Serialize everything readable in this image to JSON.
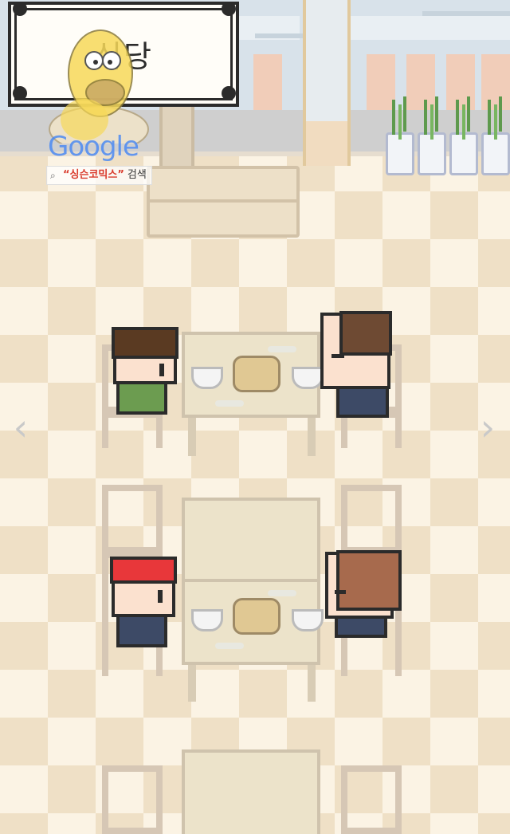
{
  "sign": {
    "title": "식당"
  },
  "navigation": {
    "prev_icon": "chevron-left-icon",
    "next_icon": "chevron-right-icon",
    "prev_glyph": "‹",
    "next_glyph": "›"
  },
  "watermark": {
    "brand": "Google",
    "search_query": "“싱슨코믹스”",
    "search_word": "검색"
  },
  "colors": {
    "floor_light": "#fbf3e4",
    "floor_dark": "#efe0c6",
    "wall": "#d8e2ea",
    "table": "#ece3ca",
    "outline": "#2b2b2b",
    "red_bandana": "#e8373a",
    "green_shirt": "#6c9c50",
    "navy_shirt": "#3d4a66"
  },
  "characters": [
    {
      "name": "boy-dark-hair",
      "shirt": "green"
    },
    {
      "name": "man-brown-hair",
      "shirt": "navy"
    },
    {
      "name": "boy-red-bandana",
      "shirt": "navy"
    },
    {
      "name": "woman-brown-hair",
      "shirt": "navy"
    }
  ]
}
